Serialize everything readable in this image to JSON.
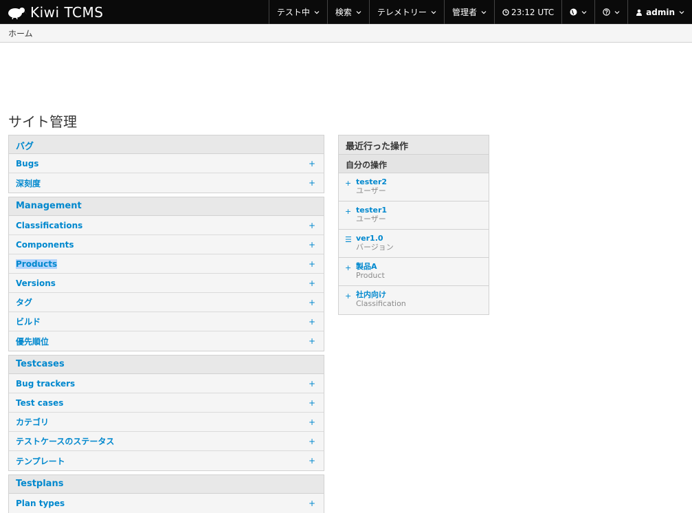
{
  "brand": {
    "name": "Kiwi TCMS"
  },
  "nav": [
    {
      "label": "テスト中",
      "icon": "chevron-down-icon"
    },
    {
      "label": "検索",
      "icon": "chevron-down-icon"
    },
    {
      "label": "テレメトリー",
      "icon": "chevron-down-icon"
    },
    {
      "label": "管理者",
      "icon": "chevron-down-icon"
    }
  ],
  "clock": {
    "label": "23:12 UTC",
    "icon": "clock-icon"
  },
  "language_icon": "globe-icon",
  "help_icon": "question-icon",
  "user": {
    "label": "admin",
    "icon": "user-icon"
  },
  "breadcrumb": "ホーム",
  "page_title": "サイト管理",
  "modules": {
    "bugs": {
      "caption": "バグ",
      "rows": [
        "Bugs",
        "深刻度"
      ]
    },
    "management": {
      "caption": "Management",
      "rows": [
        "Classifications",
        "Components",
        "Products",
        "Versions",
        "タグ",
        "ビルド",
        "優先順位"
      ]
    },
    "testcases": {
      "caption": "Testcases",
      "rows": [
        "Bug trackers",
        "Test cases",
        "カテゴリ",
        "テストケースのステータス",
        "テンプレート"
      ]
    },
    "testplans": {
      "caption": "Testplans",
      "rows": [
        "Plan types"
      ]
    }
  },
  "add_symbol": "+",
  "recent": {
    "caption": "最近行った操作",
    "subcaption": "自分の操作",
    "items": [
      {
        "icon": "+",
        "name": "tester2",
        "type": "ユーザー"
      },
      {
        "icon": "+",
        "name": "tester1",
        "type": "ユーザー"
      },
      {
        "icon": "☰",
        "name": "ver1.0",
        "type": "バージョン"
      },
      {
        "icon": "+",
        "name": "製品A",
        "type": "Product"
      },
      {
        "icon": "+",
        "name": "社内向け",
        "type": "Classification"
      }
    ]
  },
  "colors": {
    "accent": "#0088ce",
    "navbar": "#0a0a0a",
    "module_bg": "#f5f5f5",
    "selection": "#b3d4fc"
  }
}
